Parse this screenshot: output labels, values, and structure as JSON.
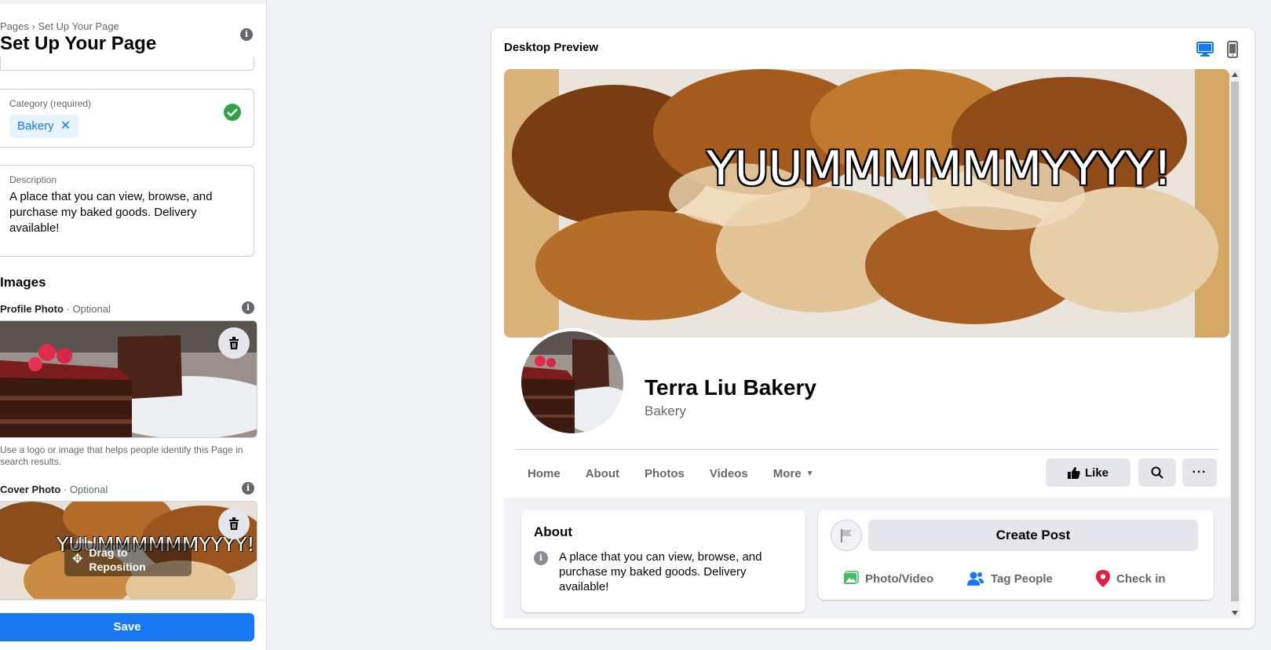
{
  "sidebar": {
    "breadcrumb": "Pages › Set Up Your Page",
    "title": "Set Up Your Page",
    "category": {
      "label": "Category (required)",
      "chip": "Bakery",
      "chip_remove": "✕"
    },
    "description": {
      "label": "Description",
      "value": "A place that you can view, browse, and purchase my baked goods. Delivery available!"
    },
    "images_title": "Images",
    "profile_photo": {
      "label": "Profile Photo",
      "suffix": " · Optional",
      "hint": "Use a logo or image that helps people identify this Page in search results."
    },
    "cover_photo": {
      "label": "Cover Photo",
      "suffix": " · Optional",
      "drag_label": "Drag to Reposition",
      "overlay_text": "YUUMMMMMMYYYY!"
    },
    "save_label": "Save"
  },
  "preview": {
    "title": "Desktop Preview",
    "devices": [
      "desktop-icon",
      "mobile-icon"
    ],
    "active_device": "desktop",
    "cover_text": "YUUMMMMMMYYYY!",
    "page_name": "Terra Liu Bakery",
    "page_category": "Bakery",
    "tabs": [
      "Home",
      "About",
      "Photos",
      "Videos",
      "More"
    ],
    "like_label": "Like",
    "about": {
      "title": "About",
      "text": "A place that you can view, browse, and purchase my baked goods. Delivery available!"
    },
    "create_post_label": "Create Post",
    "post_actions": [
      "Photo/Video",
      "Tag People",
      "Check in"
    ]
  },
  "colors": {
    "accent": "#1877f2",
    "success": "#31a24c",
    "chip_bg": "#e7f3ff",
    "page_bg": "#f0f2f5",
    "check_in": "#e41e3f",
    "photo_video": "#45bd62"
  }
}
